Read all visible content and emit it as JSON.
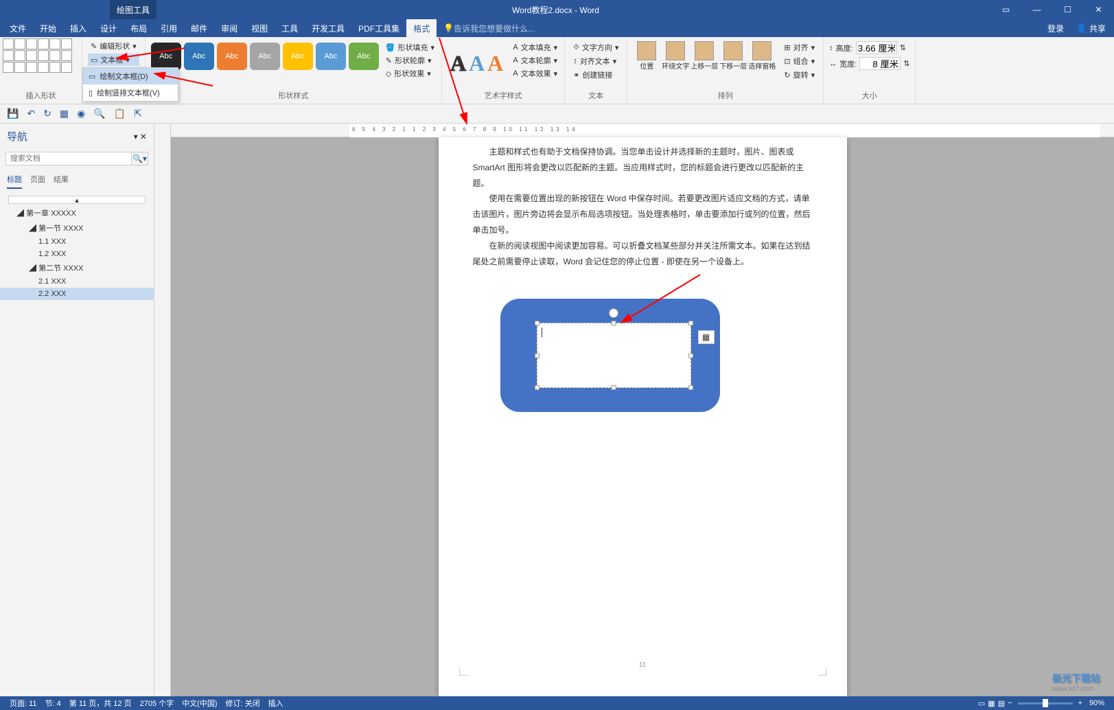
{
  "titlebar": {
    "doc_title": "Word教程2.docx - Word",
    "context_tab": "绘图工具"
  },
  "menu": {
    "items": [
      "文件",
      "开始",
      "插入",
      "设计",
      "布局",
      "引用",
      "邮件",
      "审阅",
      "视图",
      "工具",
      "开发工具",
      "PDF工具集",
      "格式"
    ],
    "tell_me": "告诉我您想要做什么...",
    "login": "登录",
    "share": "共享"
  },
  "ribbon": {
    "insert_shape": {
      "label": "插入形状",
      "edit_shape": "编辑形状",
      "text_box": "文本框",
      "dropdown": {
        "item1": "绘制文本框(D)",
        "item2": "绘制竖排文本框(V)"
      }
    },
    "shape_style": {
      "label": "形状样式",
      "swatch_text": "Abc",
      "shape_fill": "形状填充",
      "shape_outline": "形状轮廓",
      "shape_effects": "形状效果"
    },
    "wordart": {
      "label": "艺术字样式",
      "text_fill": "文本填充",
      "text_outline": "文本轮廓",
      "text_effects": "文本效果"
    },
    "text": {
      "label": "文本",
      "text_direction": "文字方向",
      "align_text": "对齐文本",
      "create_link": "创建链接"
    },
    "arrange": {
      "label": "排列",
      "position": "位置",
      "wrap": "环绕文字",
      "bring_forward": "上移一层",
      "send_backward": "下移一层",
      "selection_pane": "选择窗格",
      "align": "对齐",
      "group": "组合",
      "rotate": "旋转"
    },
    "size": {
      "label": "大小",
      "height_label": "高度:",
      "height_value": "3.66 厘米",
      "width_label": "宽度:",
      "width_value": "8 厘米"
    }
  },
  "nav": {
    "title": "导航",
    "search_placeholder": "搜索文档",
    "tabs": [
      "标题",
      "页面",
      "结果"
    ],
    "tree": [
      {
        "label": "第一章 XXXXX",
        "level": 1
      },
      {
        "label": "第一节 XXXX",
        "level": 2
      },
      {
        "label": "1.1 XXX",
        "level": 3
      },
      {
        "label": "1.2 XXX",
        "level": 3
      },
      {
        "label": "第二节 XXXX",
        "level": 2
      },
      {
        "label": "2.1 XXX",
        "level": 3
      },
      {
        "label": "2.2 XXX",
        "level": 3,
        "selected": true
      }
    ]
  },
  "doc": {
    "para1": "主题和样式也有助于文档保持协调。当您单击设计并选择新的主题时，图片、图表或 SmartArt 图形将会更改以匹配新的主题。当应用样式时，您的标题会进行更改以匹配新的主题。",
    "para2": "使用在需要位置出现的新按钮在 Word 中保存时间。若要更改图片适应文档的方式，请单击该图片，图片旁边将会显示布局选项按钮。当处理表格时，单击要添加行或列的位置，然后单击加号。",
    "para3": "在新的阅读视图中阅读更加容易。可以折叠文档某些部分并关注所需文本。如果在达到结尾处之前需要停止读取，Word 会记住您的停止位置 - 即使在另一个设备上。",
    "page_num": "11"
  },
  "status": {
    "page": "页面: 11",
    "section": "节: 4",
    "page_of": "第 11 页，共 12 页",
    "words": "2705 个字",
    "language": "中文(中国)",
    "track": "修订: 关闭",
    "insert": "插入",
    "zoom": "90%"
  },
  "watermark": {
    "text": "极光下载站",
    "url": "www.xz7.com"
  },
  "ruler": {
    "h": "6  5  4  3  2  1      1  2  3  4  5  6  7  8  9  10  11  12  13  14"
  }
}
